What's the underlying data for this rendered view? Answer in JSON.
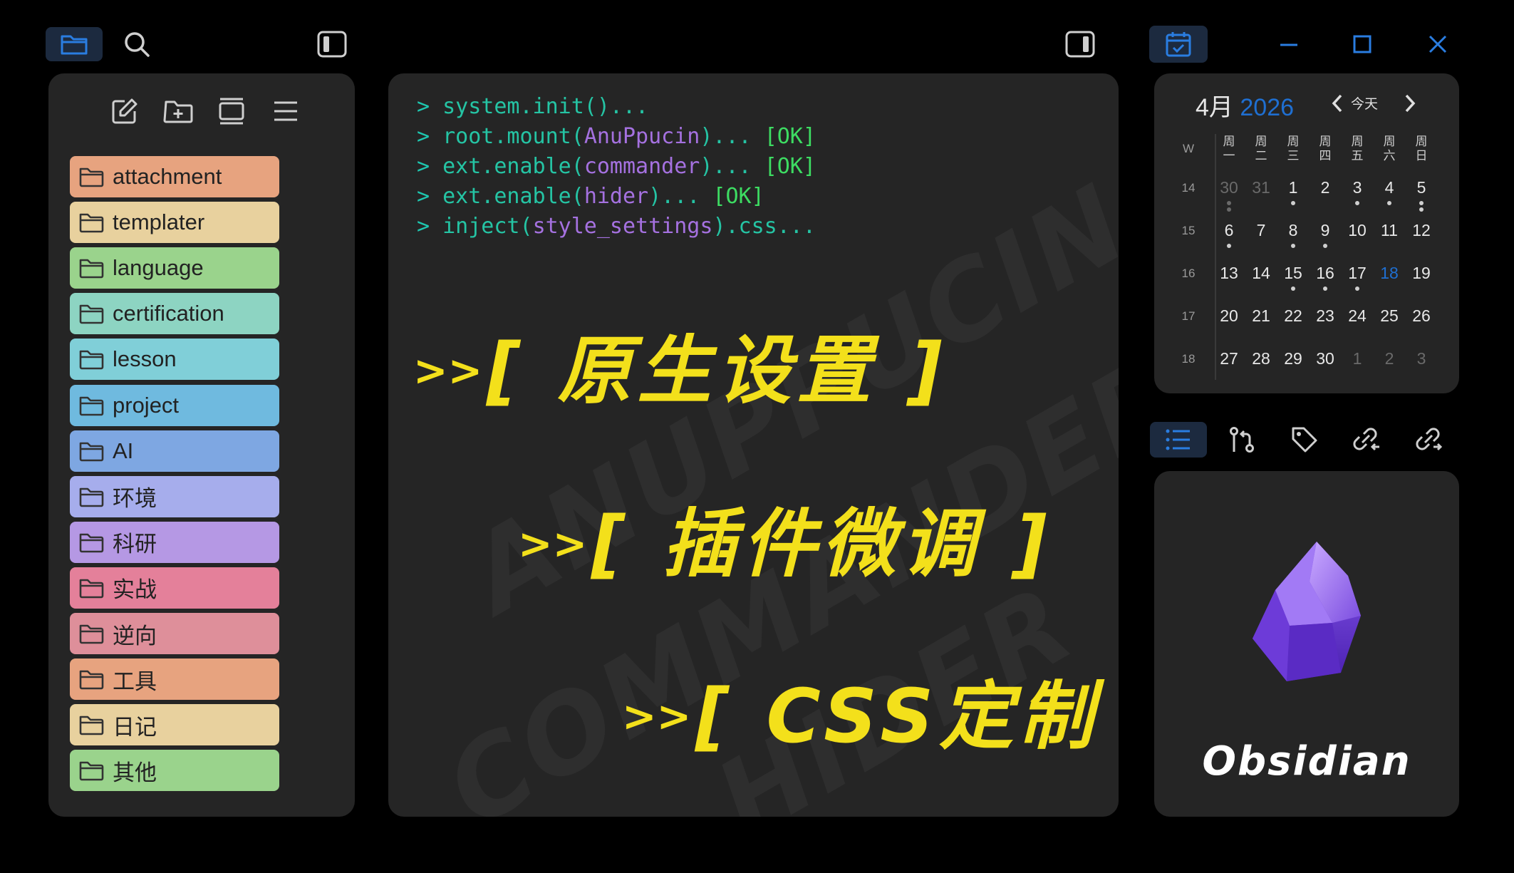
{
  "left_sidebar": {
    "top_icons": [
      "folder-icon",
      "search-icon",
      "sidebar-left-toggle-icon"
    ],
    "toolbar_icons": [
      "new-note-icon",
      "new-folder-icon",
      "collapse-icon",
      "sort-icon"
    ],
    "folders": [
      {
        "label": "attachment",
        "color": "#e7a37f"
      },
      {
        "label": "templater",
        "color": "#e8d19e"
      },
      {
        "label": "language",
        "color": "#9ad38c"
      },
      {
        "label": "certification",
        "color": "#8dd4c2"
      },
      {
        "label": "lesson",
        "color": "#80cfd8"
      },
      {
        "label": "project",
        "color": "#6fbadf"
      },
      {
        "label": "AI",
        "color": "#7ea7e2"
      },
      {
        "label": "环境",
        "color": "#a6adec"
      },
      {
        "label": "科研",
        "color": "#b598e4"
      },
      {
        "label": "实战",
        "color": "#e4809a"
      },
      {
        "label": "逆向",
        "color": "#de8f9a"
      },
      {
        "label": "工具",
        "color": "#e7a37f"
      },
      {
        "label": "日记",
        "color": "#e8d19e"
      },
      {
        "label": "其他",
        "color": "#9ad38c"
      }
    ]
  },
  "terminal": {
    "lines": [
      {
        "prompt": ">",
        "parts": [
          {
            "t": "system.init()...",
            "c": "kw"
          }
        ]
      },
      {
        "prompt": ">",
        "parts": [
          {
            "t": "root.mount(",
            "c": "kw"
          },
          {
            "t": "AnuPpucin",
            "c": "arg"
          },
          {
            "t": ")... ",
            "c": "kw"
          },
          {
            "t": "[OK]",
            "c": "ok"
          }
        ]
      },
      {
        "prompt": ">",
        "parts": [
          {
            "t": "ext.enable(",
            "c": "kw"
          },
          {
            "t": "commander",
            "c": "arg"
          },
          {
            "t": ")... ",
            "c": "kw"
          },
          {
            "t": "[OK]",
            "c": "ok"
          }
        ]
      },
      {
        "prompt": ">",
        "parts": [
          {
            "t": "ext.enable(",
            "c": "kw"
          },
          {
            "t": "hider",
            "c": "arg"
          },
          {
            "t": ")... ",
            "c": "kw"
          },
          {
            "t": "[OK]",
            "c": "ok"
          }
        ]
      },
      {
        "prompt": ">",
        "parts": [
          {
            "t": "inject(",
            "c": "kw"
          },
          {
            "t": "style_settings",
            "c": "arg"
          },
          {
            "t": ").css...",
            "c": "kw"
          }
        ]
      }
    ],
    "headlines": [
      {
        "arrows": ">>",
        "text": "[ 原生设置 ]"
      },
      {
        "arrows": ">>",
        "text": "[ 插件微调 ]"
      },
      {
        "arrows": ">>",
        "text": "[ CSS定制 ]"
      }
    ],
    "watermarks": [
      "ANUPPUCIN",
      "COMMANDER",
      "HIDER"
    ]
  },
  "window_controls": {
    "icons": [
      "calendar-icon",
      "minimize-icon",
      "maximize-icon",
      "close-icon"
    ]
  },
  "calendar": {
    "month": "4月",
    "year": "2026",
    "today_label": "今天",
    "week_header": "W",
    "weekdays": [
      [
        "周",
        "一"
      ],
      [
        "周",
        "二"
      ],
      [
        "周",
        "三"
      ],
      [
        "周",
        "四"
      ],
      [
        "周",
        "五"
      ],
      [
        "周",
        "六"
      ],
      [
        "周",
        "日"
      ]
    ],
    "weeks": [
      {
        "num": "14",
        "days": [
          "30",
          "31",
          "1",
          "2",
          "3",
          "4",
          "5"
        ]
      },
      {
        "num": "15",
        "days": [
          "6",
          "7",
          "8",
          "9",
          "10",
          "11",
          "12"
        ]
      },
      {
        "num": "16",
        "days": [
          "13",
          "14",
          "15",
          "16",
          "17",
          "18",
          "19"
        ]
      },
      {
        "num": "17",
        "days": [
          "20",
          "21",
          "22",
          "23",
          "24",
          "25",
          "26"
        ]
      },
      {
        "num": "18",
        "days": [
          "27",
          "28",
          "29",
          "30",
          "1",
          "2",
          "3"
        ]
      }
    ],
    "accent": "#1f6fd1"
  },
  "right_tabs": {
    "icons": [
      "outline-icon",
      "git-icon",
      "tag-icon",
      "backlinks-icon",
      "outgoing-links-icon"
    ]
  },
  "brand": {
    "name": "Obsidian"
  }
}
